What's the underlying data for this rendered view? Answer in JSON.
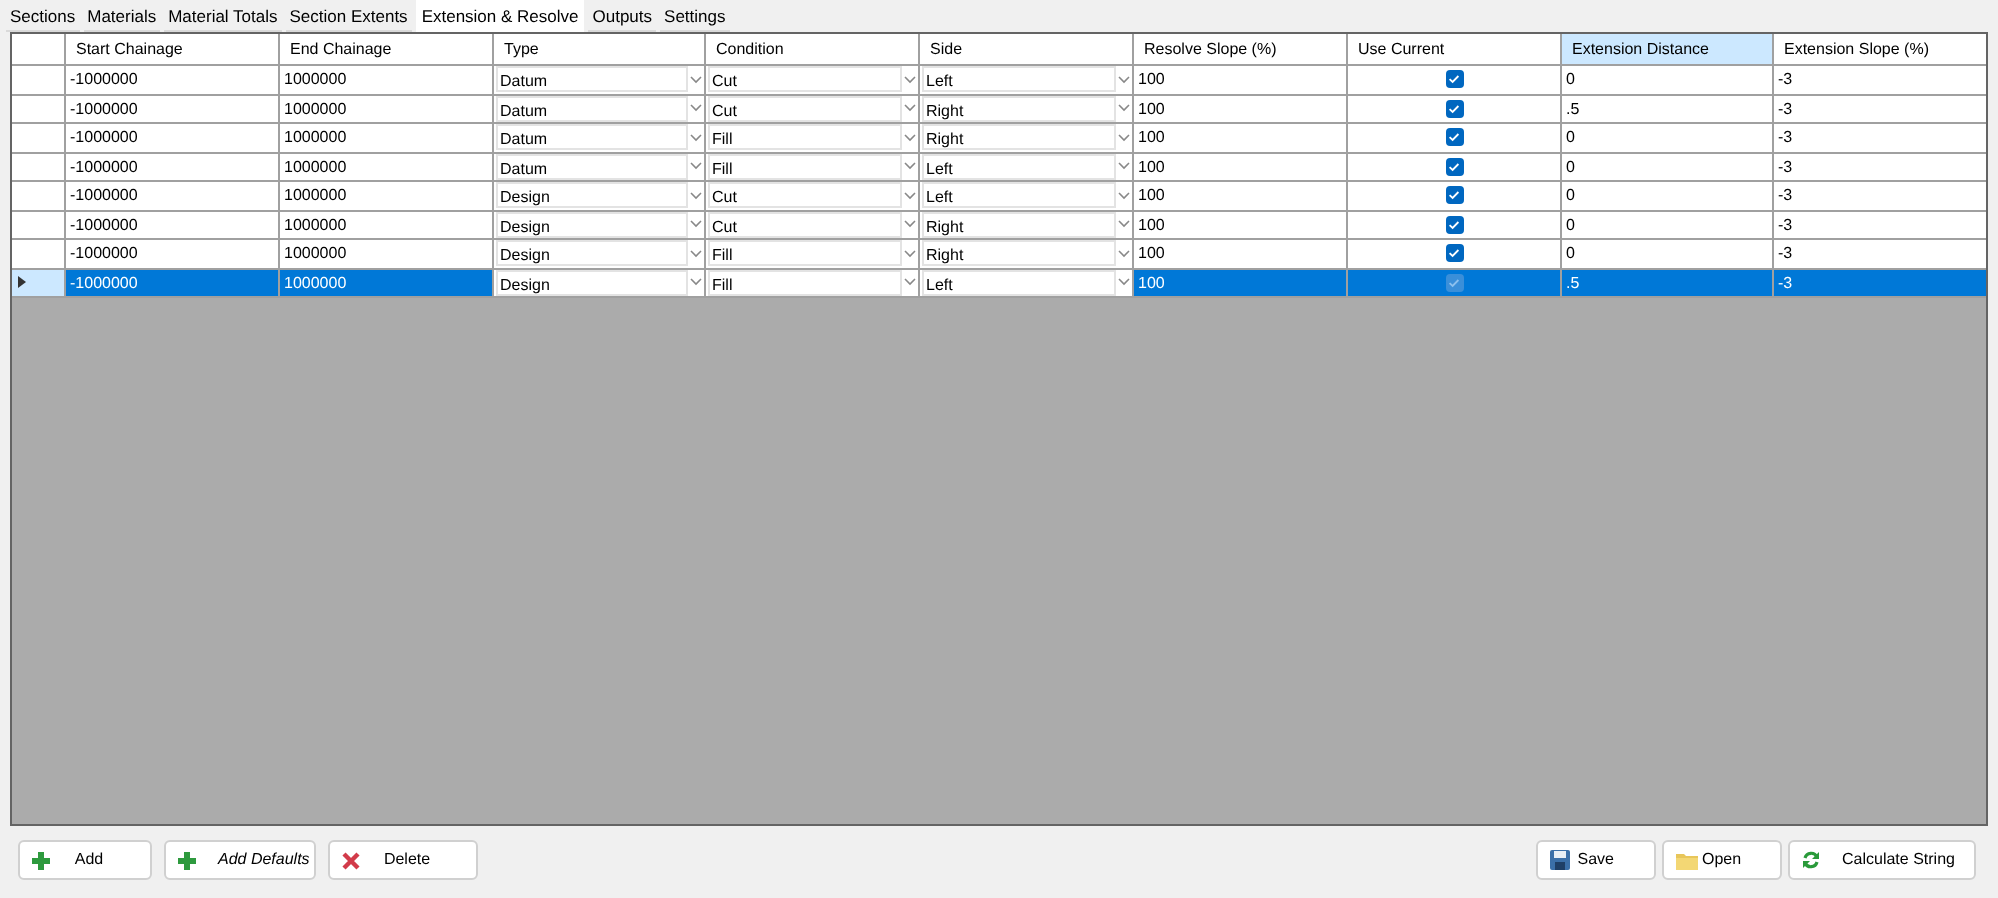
{
  "tabs": [
    {
      "label": "Sections",
      "selected": false
    },
    {
      "label": "Materials",
      "selected": false
    },
    {
      "label": "Material Totals",
      "selected": false
    },
    {
      "label": "Section Extents",
      "selected": false
    },
    {
      "label": "Extension & Resolve",
      "selected": true
    },
    {
      "label": "Outputs",
      "selected": false
    },
    {
      "label": "Settings",
      "selected": false
    }
  ],
  "table": {
    "columns": [
      {
        "label": "Start Chainage",
        "kind": "text",
        "selected": false
      },
      {
        "label": "End Chainage",
        "kind": "text",
        "selected": false
      },
      {
        "label": "Type",
        "kind": "combo",
        "selected": false
      },
      {
        "label": "Condition",
        "kind": "combo",
        "selected": false
      },
      {
        "label": "Side",
        "kind": "combo",
        "selected": false
      },
      {
        "label": "Resolve Slope (%)",
        "kind": "text",
        "selected": false
      },
      {
        "label": "Use Current",
        "kind": "check",
        "selected": false
      },
      {
        "label": "Extension Distance",
        "kind": "text",
        "selected": true
      },
      {
        "label": "Extension Slope (%)",
        "kind": "text",
        "selected": false
      }
    ],
    "rows": [
      {
        "selected": false,
        "cells": [
          "-1000000",
          "1000000",
          "Datum",
          "Cut",
          "Left",
          "100",
          true,
          "0",
          "-3"
        ]
      },
      {
        "selected": false,
        "cells": [
          "-1000000",
          "1000000",
          "Datum",
          "Cut",
          "Right",
          "100",
          true,
          ".5",
          "-3"
        ]
      },
      {
        "selected": false,
        "cells": [
          "-1000000",
          "1000000",
          "Datum",
          "Fill",
          "Right",
          "100",
          true,
          "0",
          "-3"
        ]
      },
      {
        "selected": false,
        "cells": [
          "-1000000",
          "1000000",
          "Datum",
          "Fill",
          "Left",
          "100",
          true,
          "0",
          "-3"
        ]
      },
      {
        "selected": false,
        "cells": [
          "-1000000",
          "1000000",
          "Design",
          "Cut",
          "Left",
          "100",
          true,
          "0",
          "-3"
        ]
      },
      {
        "selected": false,
        "cells": [
          "-1000000",
          "1000000",
          "Design",
          "Cut",
          "Right",
          "100",
          true,
          "0",
          "-3"
        ]
      },
      {
        "selected": false,
        "cells": [
          "-1000000",
          "1000000",
          "Design",
          "Fill",
          "Right",
          "100",
          true,
          "0",
          "-3"
        ]
      },
      {
        "selected": true,
        "cells": [
          "-1000000",
          "1000000",
          "Design",
          "Fill",
          "Left",
          "100",
          true,
          ".5",
          "-3"
        ]
      }
    ]
  },
  "left_buttons": [
    {
      "label": "Add",
      "kind": "add"
    },
    {
      "label": "Add Defaults",
      "kind": "add-defaults"
    },
    {
      "label": "Delete",
      "kind": "delete"
    }
  ],
  "right_buttons": [
    {
      "label": "Save",
      "kind": "save"
    },
    {
      "label": "Open",
      "kind": "open"
    },
    {
      "label": "Calculate String",
      "kind": "calculate"
    }
  ]
}
